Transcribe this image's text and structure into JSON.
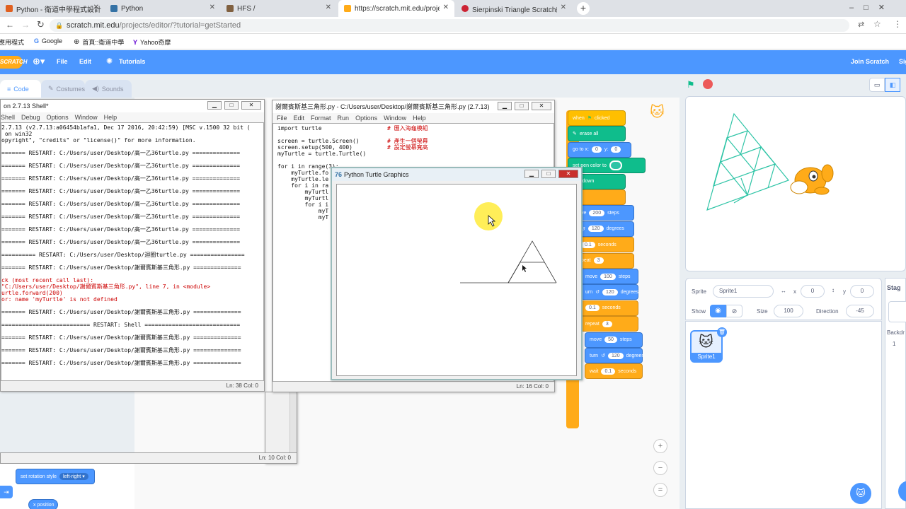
{
  "tabs": [
    {
      "title": "Python - 衛道中學程式設計",
      "color": "#e06020"
    },
    {
      "title": "Python",
      "color": "#3572a5"
    },
    {
      "title": "HFS /",
      "color": "#806040"
    },
    {
      "title": "https://scratch.mit.edu/project",
      "color": "#ffab19"
    },
    {
      "title": "Sierpinski Triangle Scratch繪圖",
      "color": "#cc2233"
    }
  ],
  "address": {
    "host": "scratch.mit.edu",
    "path": "/projects/editor/?tutorial=getStarted"
  },
  "bookmarks": [
    {
      "label": "應用程式"
    },
    {
      "label": "Google"
    },
    {
      "label": "首頁::衛道中學"
    },
    {
      "label": "Yahoo奇摩"
    }
  ],
  "scratch_menu": {
    "logo": "SCRATCH",
    "file": "File",
    "edit": "Edit",
    "tutorials": "Tutorials",
    "join": "Join Scratch",
    "signin": "Sig"
  },
  "editor_tabs": {
    "code": "Code",
    "costumes": "Costumes",
    "sounds": "Sounds"
  },
  "shell": {
    "title": "on 2.7.13 Shell*",
    "menu": [
      "Shell",
      "Debug",
      "Options",
      "Window",
      "Help"
    ],
    "lines": [
      {
        "t": "2.7.13 (v2.7.13:a06454b1afa1, Dec 17 2016, 20:42:59) [MSC v.1500 32 bit (",
        "c": ""
      },
      {
        "t": " on win32",
        "c": ""
      },
      {
        "t": "opyright\", \"credits\" or \"license()\" for more information.",
        "c": ""
      },
      {
        "t": "",
        "c": ""
      },
      {
        "t": "======= RESTART: C:/Users/user/Desktop/高一乙36turtle.py ==============",
        "c": ""
      },
      {
        "t": "",
        "c": ""
      },
      {
        "t": "======= RESTART: C:/Users/user/Desktop/高一乙36turtle.py ==============",
        "c": ""
      },
      {
        "t": "",
        "c": ""
      },
      {
        "t": "======= RESTART: C:/Users/user/Desktop/高一乙36turtle.py ==============",
        "c": ""
      },
      {
        "t": "",
        "c": ""
      },
      {
        "t": "======= RESTART: C:/Users/user/Desktop/高一乙36turtle.py ==============",
        "c": ""
      },
      {
        "t": "",
        "c": ""
      },
      {
        "t": "======= RESTART: C:/Users/user/Desktop/高一乙36turtle.py ==============",
        "c": ""
      },
      {
        "t": "",
        "c": ""
      },
      {
        "t": "======= RESTART: C:/Users/user/Desktop/高一乙36turtle.py ==============",
        "c": ""
      },
      {
        "t": "",
        "c": ""
      },
      {
        "t": "======= RESTART: C:/Users/user/Desktop/高一乙36turtle.py ==============",
        "c": ""
      },
      {
        "t": "",
        "c": ""
      },
      {
        "t": "======= RESTART: C:/Users/user/Desktop/高一乙36turtle.py ==============",
        "c": ""
      },
      {
        "t": "",
        "c": ""
      },
      {
        "t": "========== RESTART: C:/Users/user/Desktop/迴圈turtle.py ================",
        "c": ""
      },
      {
        "t": "",
        "c": ""
      },
      {
        "t": "======= RESTART: C:/Users/user/Desktop/謝爾賓斯基三角形.py ==============",
        "c": ""
      },
      {
        "t": "",
        "c": ""
      },
      {
        "t": "ck (most recent call last):",
        "c": "red"
      },
      {
        "t": "\"C:/Users/user/Desktop/謝爾賓斯基三角形.py\", line 7, in <module>",
        "c": "red"
      },
      {
        "t": "urtle.forward(200)",
        "c": "red"
      },
      {
        "t": "or: name 'myTurtle' is not defined",
        "c": "red"
      },
      {
        "t": "",
        "c": ""
      },
      {
        "t": "======= RESTART: C:/Users/user/Desktop/謝爾賓斯基三角形.py ==============",
        "c": ""
      },
      {
        "t": "",
        "c": ""
      },
      {
        "t": "========================== RESTART: Shell ============================",
        "c": ""
      },
      {
        "t": "",
        "c": ""
      },
      {
        "t": "======= RESTART: C:/Users/user/Desktop/謝爾賓斯基三角形.py ==============",
        "c": ""
      },
      {
        "t": "",
        "c": ""
      },
      {
        "t": "======= RESTART: C:/Users/user/Desktop/謝爾賓斯基三角形.py ==============",
        "c": ""
      },
      {
        "t": "",
        "c": ""
      },
      {
        "t": "======= RESTART: C:/Users/user/Desktop/謝爾賓斯基三角形.py ==============",
        "c": ""
      }
    ],
    "status": "Ln: 38   Col: 0"
  },
  "bgwin_status": "Ln: 10   Col: 0",
  "editor": {
    "title": "謝爾賓斯基三角形.py - C:/Users/user/Desktop/謝爾賓斯基三角形.py (2.7.13)",
    "menu": [
      "File",
      "Edit",
      "Format",
      "Run",
      "Options",
      "Window",
      "Help"
    ],
    "lines": [
      {
        "code": "import turtle",
        "comment": "# 匯入海龜模組"
      },
      {
        "code": "",
        "comment": ""
      },
      {
        "code": "screen = turtle.Screen()",
        "comment": "# 產生一個螢幕"
      },
      {
        "code": "screen.setup(500, 400)",
        "comment": "# 設定螢幕寬高"
      },
      {
        "code": "myTurtle = turtle.Turtle()",
        "comment": ""
      },
      {
        "code": "",
        "comment": ""
      },
      {
        "code": "for i in range(3):",
        "comment": ""
      },
      {
        "code": "    myTurtle.fo",
        "comment": ""
      },
      {
        "code": "    myTurtle.le",
        "comment": ""
      },
      {
        "code": "    for i in ra",
        "comment": ""
      },
      {
        "code": "        myTurtl",
        "comment": ""
      },
      {
        "code": "        myTurtl",
        "comment": ""
      },
      {
        "code": "        for i i",
        "comment": ""
      },
      {
        "code": "            myT",
        "comment": ""
      },
      {
        "code": "            myT",
        "comment": ""
      }
    ],
    "status": "Ln: 16   Col: 0"
  },
  "turtle_window": {
    "title": "Python Turtle Graphics"
  },
  "blocks": [
    {
      "text": "when",
      "extra": "clicked",
      "cls": "ev",
      "x": 0
    },
    {
      "text": "erase all",
      "cls": "pe",
      "x": 0
    },
    {
      "text": "go to x:",
      "v1": "0",
      "mid": "y:",
      "v2": "0",
      "cls": "mo",
      "x": 0
    },
    {
      "text": "set pen color to",
      "cls": "pe",
      "x": 0
    },
    {
      "text": "pen down",
      "cls": "pe",
      "x": 0
    },
    {
      "text": "",
      "v1": "3",
      "cls": "ct",
      "x": 0
    },
    {
      "text": "ve",
      "v1": "200",
      "mid": "steps",
      "cls": "mo",
      "x": 12
    },
    {
      "text": "",
      "v1": "120",
      "mid": "degrees",
      "cls": "mo",
      "x": 12
    },
    {
      "text": "",
      "v1": "0.1",
      "mid": "seconds",
      "cls": "ct",
      "x": 12
    },
    {
      "text": "peat",
      "v1": "3",
      "cls": "ct",
      "x": 12
    },
    {
      "text": "move",
      "v1": "100",
      "mid": "steps",
      "cls": "mo",
      "x": 18
    },
    {
      "text": "urn",
      "v1": "120",
      "mid": "degrees",
      "cls": "mo",
      "x": 18
    },
    {
      "text": "",
      "v1": "0.1",
      "mid": "seconds",
      "cls": "ct",
      "x": 18
    },
    {
      "text": "repeat",
      "v1": "3",
      "cls": "ct",
      "x": 18
    },
    {
      "text": "move",
      "v1": "50",
      "mid": "steps",
      "cls": "mo",
      "x": 24
    },
    {
      "text": "turn",
      "v1": "120",
      "mid": "degrees",
      "cls": "mo",
      "x": 24
    },
    {
      "text": "wait",
      "v1": "0.1",
      "mid": "seconds",
      "cls": "ct",
      "x": 24
    }
  ],
  "palette_blocks": {
    "rotation": "set rotation style",
    "rotation_value": "left-right",
    "xpos": "x position"
  },
  "sprite": {
    "label": "Sprite",
    "name": "Sprite1",
    "x_label": "x",
    "x": "0",
    "y_label": "y",
    "y": "0",
    "show_label": "Show",
    "size_label": "Size",
    "size": "100",
    "direction_label": "Direction",
    "direction": "-45",
    "thumb_name": "Sprite1"
  },
  "stage_side": {
    "label": "Stag",
    "backdrops": "Backdr",
    "count": "1"
  },
  "colors": {
    "scratch_blue": "#4c97ff",
    "pen_color": "#2ec4a6"
  }
}
